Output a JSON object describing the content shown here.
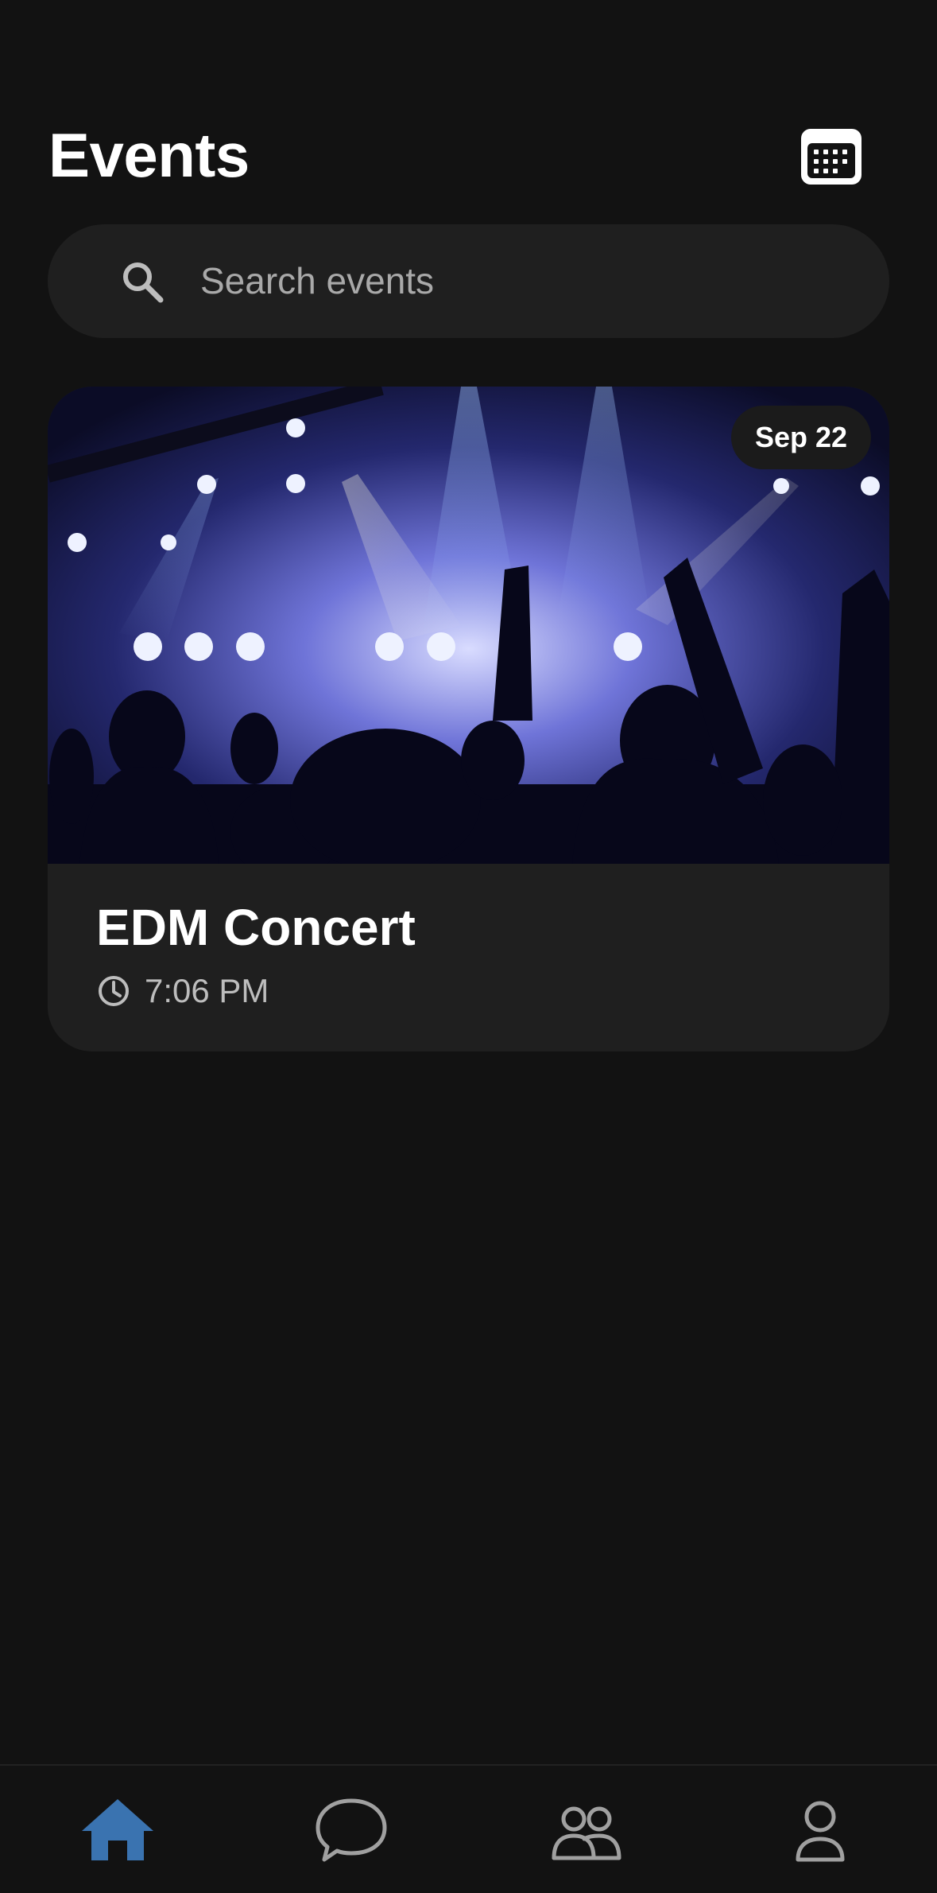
{
  "header": {
    "title": "Events",
    "calendar_icon": "calendar-icon"
  },
  "search": {
    "placeholder": "Search events",
    "value": "",
    "icon": "search-icon"
  },
  "events": [
    {
      "title": "EDM Concert",
      "date_badge": "Sep 22",
      "time": "7:06 PM",
      "time_icon": "clock-icon",
      "image": "concert-crowd-stage-lights"
    }
  ],
  "bottom_nav": {
    "items": [
      {
        "icon": "home-icon",
        "active": true
      },
      {
        "icon": "chat-icon",
        "active": false
      },
      {
        "icon": "people-icon",
        "active": false
      },
      {
        "icon": "profile-icon",
        "active": false
      }
    ]
  },
  "colors": {
    "background": "#121212",
    "surface": "#1f1f1f",
    "accent": "#3a73b0",
    "text_primary": "#ffffff",
    "text_secondary": "#bdbdbd",
    "icon_inactive": "#a0a0a0"
  }
}
